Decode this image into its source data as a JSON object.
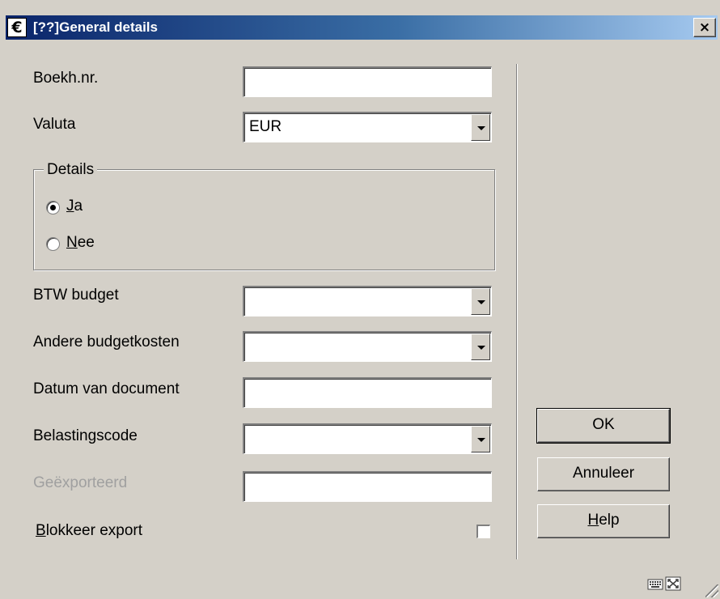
{
  "window": {
    "title": "[??]General details",
    "icon": "euro-icon",
    "icon_glyph": "€",
    "close_glyph": "×"
  },
  "form": {
    "boekh_nr": {
      "label": "Boekh.nr.",
      "value": ""
    },
    "valuta": {
      "label": "Valuta",
      "value": "EUR"
    },
    "details": {
      "legend": "Details",
      "options": [
        {
          "accel": "J",
          "rest": "a",
          "selected": true
        },
        {
          "accel": "N",
          "rest": "ee",
          "selected": false
        }
      ]
    },
    "btw_budget": {
      "label": "BTW budget",
      "value": ""
    },
    "andere_budgetkosten": {
      "label": "Andere budgetkosten",
      "value": ""
    },
    "datum_document": {
      "label": "Datum van document",
      "value": ""
    },
    "belastingscode": {
      "label": "Belastingscode",
      "value": ""
    },
    "geexporteerd": {
      "label": "Geëxporteerd",
      "value": "",
      "disabled": true
    },
    "blokkeer_export": {
      "accel": "B",
      "rest": "lokkeer export",
      "checked": false
    }
  },
  "buttons": {
    "ok": "OK",
    "annuleer": "Annuleer",
    "help": {
      "accel": "H",
      "rest": "elp"
    }
  },
  "status_icons": [
    "keyboard-icon",
    "maximize-icon"
  ],
  "colors": {
    "title_start": "#0a246a",
    "title_end": "#a6caf0",
    "face": "#d4d0c8",
    "disabled_text": "#a0a0a0"
  }
}
